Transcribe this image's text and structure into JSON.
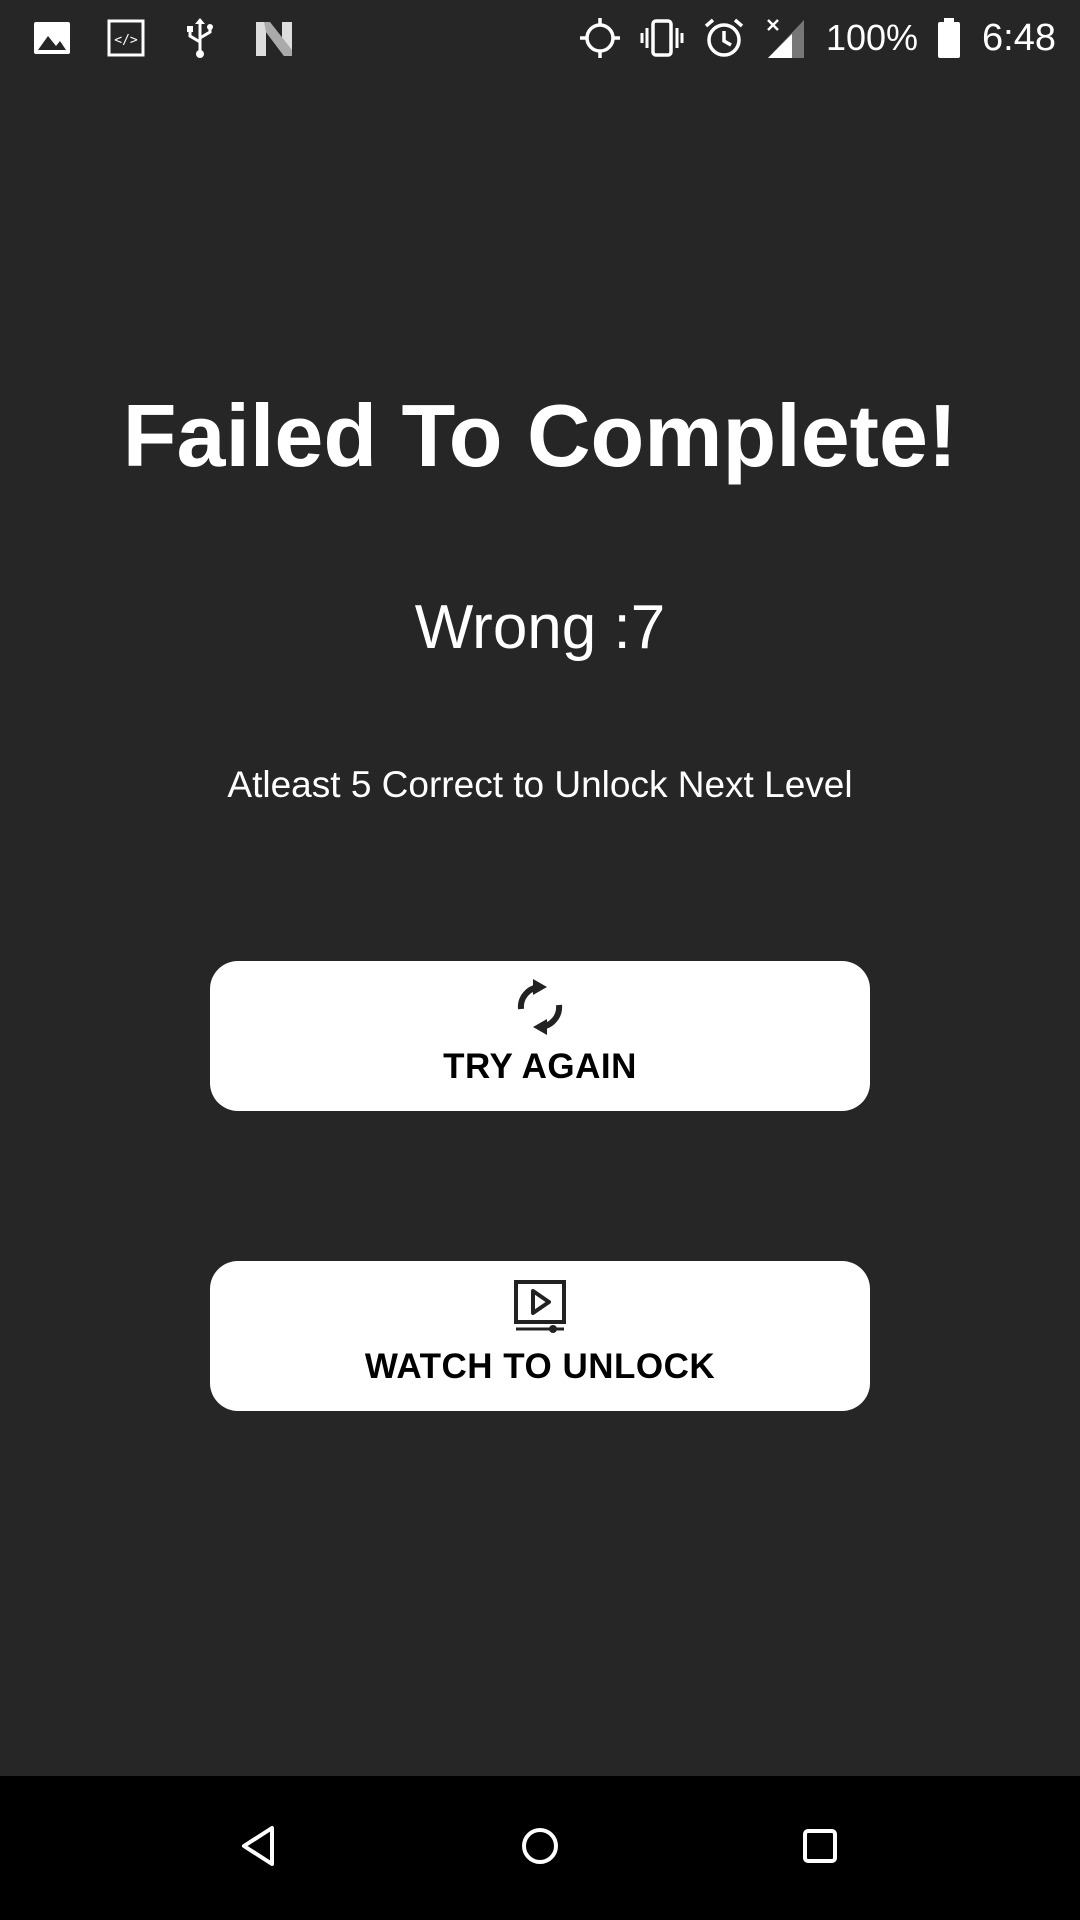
{
  "status_bar": {
    "left_icons": [
      "image-icon",
      "code-icon",
      "usb-icon",
      "n-logo-icon"
    ],
    "right_icons": [
      "location-target-icon",
      "vibrate-icon",
      "alarm-icon",
      "signal-icon"
    ],
    "battery_percent": "100%",
    "battery_icon": "battery-full-icon",
    "time": "6:48"
  },
  "result": {
    "title": "Failed To Complete!",
    "wrong_count": "Wrong :7",
    "hint": "Atleast 5 Correct to Unlock Next Level"
  },
  "buttons": {
    "try_again": {
      "label": "TRY AGAIN",
      "icon": "refresh-icon"
    },
    "watch_unlock": {
      "label": "WATCH TO UNLOCK",
      "icon": "video-play-icon"
    }
  },
  "nav_bar": {
    "back_icon": "back-triangle-icon",
    "home_icon": "home-circle-icon",
    "recents_icon": "recents-square-icon"
  },
  "colors": {
    "background": "#262626",
    "text": "#ffffff",
    "button_bg": "#ffffff",
    "button_text": "#000000",
    "nav_bar_bg": "#000000"
  }
}
